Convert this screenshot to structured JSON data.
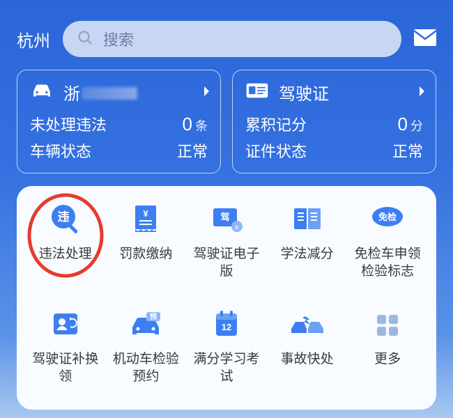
{
  "city": "杭州",
  "search": {
    "placeholder": "搜索"
  },
  "vehicle": {
    "plate_prefix": "浙",
    "row1_label": "未处理违法",
    "row1_value": "0",
    "row1_unit": "条",
    "row2_label": "车辆状态",
    "row2_value": "正常"
  },
  "license": {
    "title": "驾驶证",
    "row1_label": "累积记分",
    "row1_value": "0",
    "row1_unit": "分",
    "row2_label": "证件状态",
    "row2_value": "正常"
  },
  "services": {
    "items": [
      {
        "label": "违法处理",
        "icon": "violation",
        "highlighted": true
      },
      {
        "label": "罚款缴纳",
        "icon": "fine"
      },
      {
        "label": "驾驶证电子版",
        "icon": "elicense"
      },
      {
        "label": "学法减分",
        "icon": "study"
      },
      {
        "label": "免检车申领检验标志",
        "icon": "exempt"
      },
      {
        "label": "驾驶证补换领",
        "icon": "renew"
      },
      {
        "label": "机动车检验预约",
        "icon": "inspect"
      },
      {
        "label": "满分学习考试",
        "icon": "fullpoint",
        "badge_num": "12"
      },
      {
        "label": "事故快处",
        "icon": "accident"
      },
      {
        "label": "更多",
        "icon": "more"
      }
    ]
  },
  "colors": {
    "accent": "#3d7ff2"
  }
}
